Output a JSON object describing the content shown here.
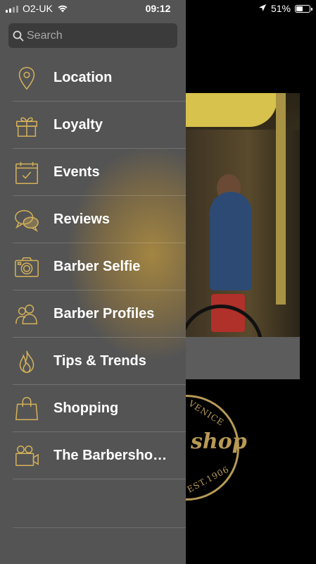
{
  "status_bar": {
    "carrier": "O2-UK",
    "time": "09:12",
    "battery_percent": "51%",
    "battery_level": 0.51
  },
  "search": {
    "placeholder": "Search",
    "value": ""
  },
  "menu": {
    "items": [
      {
        "label": "Location",
        "icon": "location-pin-icon"
      },
      {
        "label": "Loyalty",
        "icon": "gift-icon"
      },
      {
        "label": "Events",
        "icon": "calendar-check-icon"
      },
      {
        "label": "Reviews",
        "icon": "chat-bubbles-icon"
      },
      {
        "label": "Barber Selfie",
        "icon": "camera-icon"
      },
      {
        "label": "Barber Profiles",
        "icon": "people-icon"
      },
      {
        "label": "Tips & Trends",
        "icon": "flame-icon"
      },
      {
        "label": "Shopping",
        "icon": "shopping-bag-icon"
      },
      {
        "label": "The Barbersho…",
        "icon": "video-camera-icon"
      }
    ]
  },
  "background_logo": {
    "top_text": "VENICE",
    "main_text": "shop",
    "bottom_text": "EST.1906"
  },
  "colors": {
    "drawer_bg": "#545454",
    "accent_gold": "#d4b15a",
    "search_bg": "#3b3b3b",
    "text": "#ffffff"
  }
}
